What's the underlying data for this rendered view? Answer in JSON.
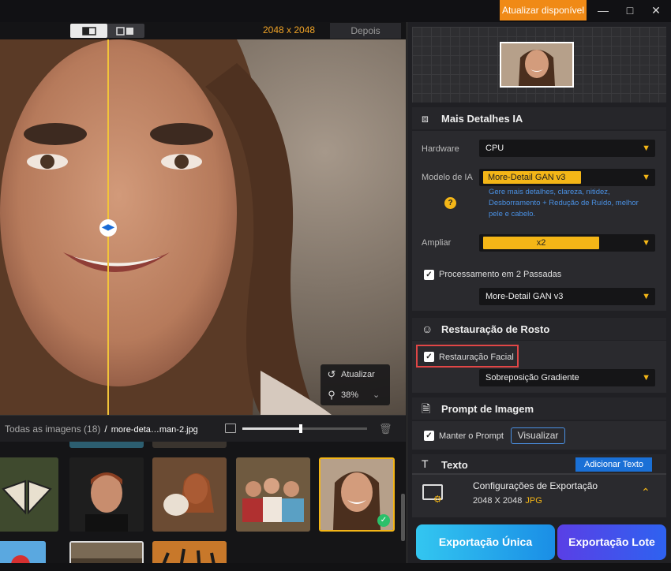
{
  "titlebar": {
    "update_label": "Atualizar disponível",
    "minimize_icon": "minimize-icon",
    "maximize_icon": "maximize-icon",
    "close_icon": "close-icon"
  },
  "viewer": {
    "dimensions": "2048 x 2048",
    "after_label": "Depois",
    "refresh_label": "Atualizar",
    "zoom_level": "38%"
  },
  "gallery": {
    "all_images_label": "Todas as imagens (18)",
    "separator": "/",
    "current_file": "more-deta…man-2.jpg",
    "zoom_fraction": 0.47
  },
  "panel": {
    "more_details": {
      "title": "Mais Detalhes IA",
      "hardware_label": "Hardware",
      "hardware_value": "CPU",
      "model_label": "Modelo de IA",
      "model_value": "More-Detail GAN  v3",
      "model_description": "Gere mais detalhes, clareza, nitidez, Desborramento + Redução de Ruído, melhor pele e cabelo.",
      "upscale_label": "Ampliar",
      "upscale_value": "x2",
      "two_pass_label": "Processamento em 2 Passadas",
      "two_pass_checked": true,
      "second_model_value": "More-Detail GAN  v3"
    },
    "face": {
      "title": "Restauração de Rosto",
      "restore_label": "Restauração Facial",
      "restore_checked": true,
      "blend_value": "Sobreposição Gradiente"
    },
    "prompt": {
      "title": "Prompt de Imagem",
      "keep_label": "Manter o Prompt",
      "keep_checked": true,
      "view_button": "Visualizar"
    },
    "text": {
      "title": "Texto",
      "add_button": "Adicionar Texto"
    },
    "export": {
      "title": "Configurações de Exportação",
      "size": "2048 X 2048",
      "format": "JPG",
      "single_button": "Exportação Única",
      "batch_button": "Exportação Lote"
    }
  },
  "colors": {
    "accent": "#f4b617",
    "update": "#f08a16",
    "link": "#4a90e2",
    "highlight": "#e04646"
  }
}
